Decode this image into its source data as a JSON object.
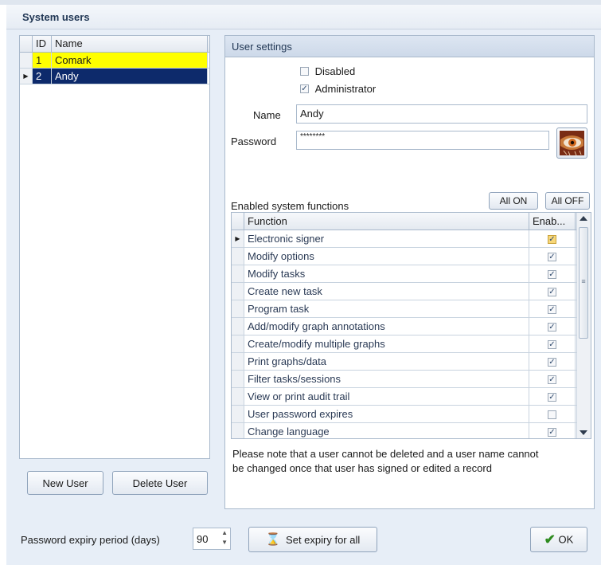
{
  "window": {
    "title": "System users"
  },
  "user_list": {
    "columns": [
      "ID",
      "Name"
    ],
    "rows": [
      {
        "id": "1",
        "name": "Comark"
      },
      {
        "id": "2",
        "name": "Andy"
      }
    ]
  },
  "buttons": {
    "new_user": "New User",
    "delete_user": "Delete User",
    "all_on": "All ON",
    "all_off": "All OFF",
    "set_expiry": "Set expiry for all",
    "ok": "OK"
  },
  "settings": {
    "title": "User settings",
    "disabled_label": "Disabled",
    "disabled_checked": false,
    "admin_label": "Administrator",
    "admin_checked": true,
    "name_label": "Name",
    "name_value": "Andy",
    "password_label": "Password",
    "password_value": "********",
    "functions_label": "Enabled system functions",
    "functions_columns": [
      "Function",
      "Enab..."
    ],
    "functions": [
      {
        "name": "Electronic signer",
        "enabled": true
      },
      {
        "name": "Modify options",
        "enabled": true
      },
      {
        "name": "Modify tasks",
        "enabled": true
      },
      {
        "name": "Create new task",
        "enabled": true
      },
      {
        "name": "Program task",
        "enabled": true
      },
      {
        "name": "Add/modify graph annotations",
        "enabled": true
      },
      {
        "name": "Create/modify multiple graphs",
        "enabled": true
      },
      {
        "name": "Print graphs/data",
        "enabled": true
      },
      {
        "name": "Filter tasks/sessions",
        "enabled": true
      },
      {
        "name": "View or print audit trail",
        "enabled": true
      },
      {
        "name": "User password expires",
        "enabled": false
      },
      {
        "name": "Change language",
        "enabled": true
      }
    ],
    "note_line1": "Please note that a user cannot be deleted and a user name cannot",
    "note_line2": "be changed once that user has signed or edited a record"
  },
  "expiry": {
    "label": "Password expiry period (days)",
    "value": "90"
  },
  "colors": {
    "highlight_yellow": "#ffff00",
    "selected_navy": "#0d2a6b",
    "accent_check": "#2e8b1f"
  }
}
